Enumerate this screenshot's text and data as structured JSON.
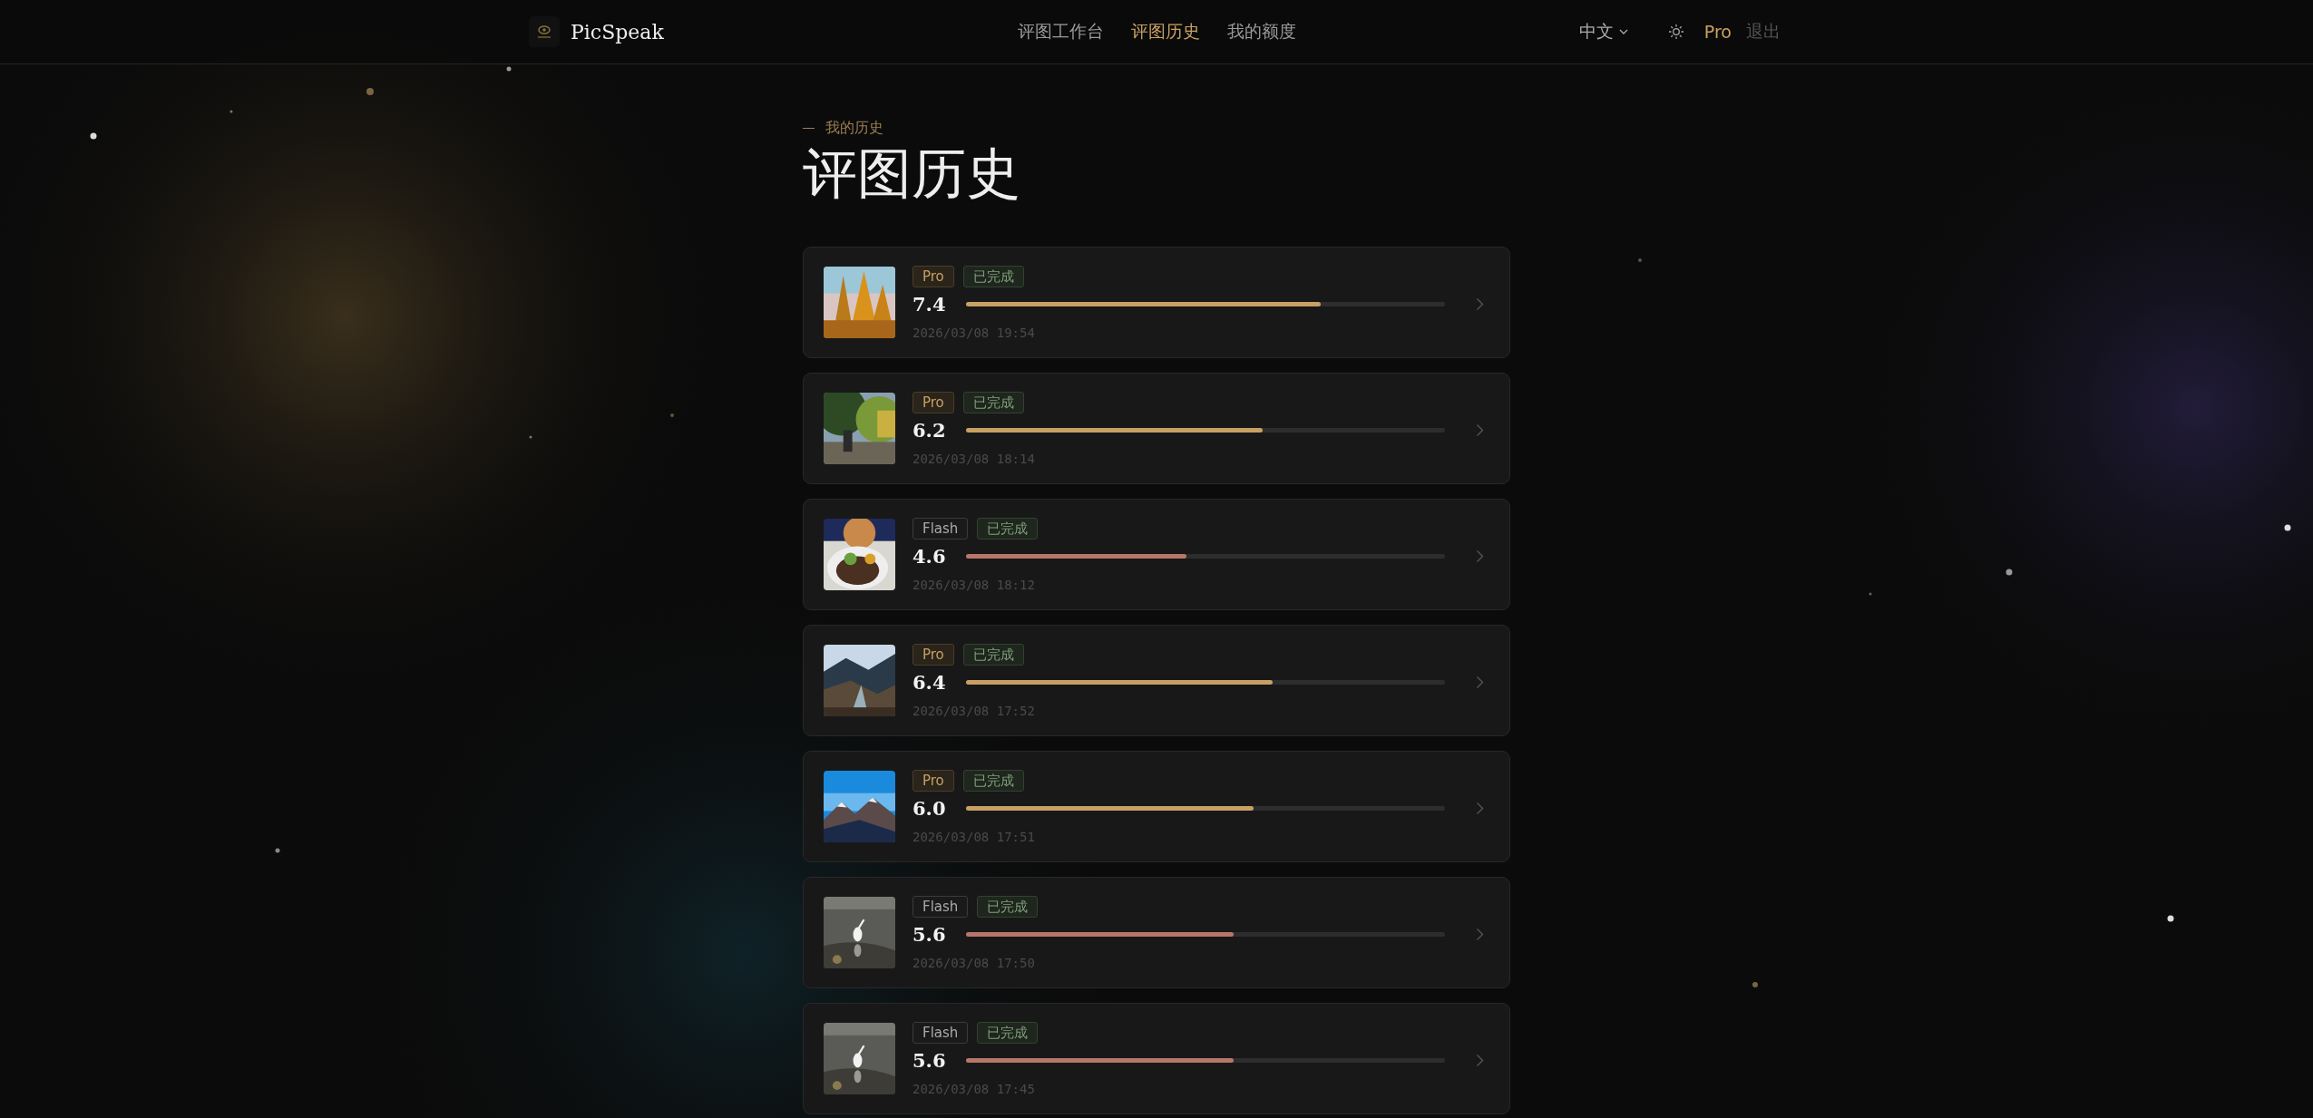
{
  "header": {
    "brand": "PicSpeak",
    "nav": [
      {
        "label": "评图工作台",
        "selected": false
      },
      {
        "label": "评图历史",
        "selected": true
      },
      {
        "label": "我的额度",
        "selected": false
      }
    ],
    "language": "中文",
    "plan": "Pro",
    "logout": "退出"
  },
  "page": {
    "eyebrow": "我的历史",
    "title": "评图历史"
  },
  "items": [
    {
      "tags": [
        {
          "label": "Pro",
          "kind": "pro"
        },
        {
          "label": "已完成",
          "kind": "done"
        }
      ],
      "score": "7.4",
      "level": 0.74,
      "color": "#c9a063",
      "time": "2026/03/08 19:54"
    },
    {
      "tags": [
        {
          "label": "Pro",
          "kind": "pro"
        },
        {
          "label": "已完成",
          "kind": "done"
        }
      ],
      "score": "6.2",
      "level": 0.62,
      "color": "#c9a063",
      "time": "2026/03/08 18:14"
    },
    {
      "tags": [
        {
          "label": "Flash",
          "kind": "flash"
        },
        {
          "label": "已完成",
          "kind": "done"
        }
      ],
      "score": "4.6",
      "level": 0.46,
      "color": "#b8766a",
      "time": "2026/03/08 18:12"
    },
    {
      "tags": [
        {
          "label": "Pro",
          "kind": "pro"
        },
        {
          "label": "已完成",
          "kind": "done"
        }
      ],
      "score": "6.4",
      "level": 0.64,
      "color": "#c9a063",
      "time": "2026/03/08 17:52"
    },
    {
      "tags": [
        {
          "label": "Pro",
          "kind": "pro"
        },
        {
          "label": "已完成",
          "kind": "done"
        }
      ],
      "score": "6.0",
      "level": 0.6,
      "color": "#c9a063",
      "time": "2026/03/08 17:51"
    },
    {
      "tags": [
        {
          "label": "Flash",
          "kind": "flash"
        },
        {
          "label": "已完成",
          "kind": "done"
        }
      ],
      "score": "5.6",
      "level": 0.56,
      "color": "#b8766a",
      "time": "2026/03/08 17:50"
    },
    {
      "tags": [
        {
          "label": "Flash",
          "kind": "flash"
        },
        {
          "label": "已完成",
          "kind": "done"
        }
      ],
      "score": "5.6",
      "level": 0.56,
      "color": "#b8766a",
      "time": "2026/03/08 17:45"
    }
  ]
}
